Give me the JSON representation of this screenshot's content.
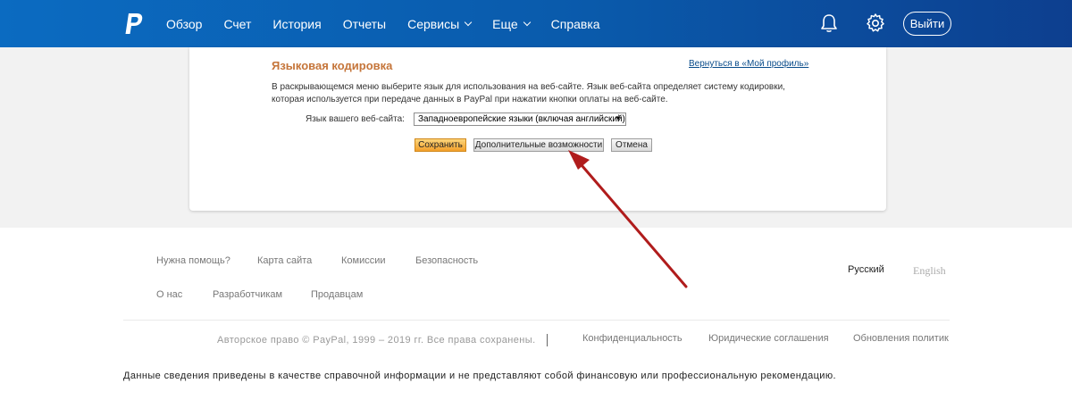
{
  "header": {
    "nav": [
      {
        "label": "Обзор",
        "has_dropdown": false
      },
      {
        "label": "Счет",
        "has_dropdown": false
      },
      {
        "label": "История",
        "has_dropdown": false
      },
      {
        "label": "Отчеты",
        "has_dropdown": false
      },
      {
        "label": "Сервисы",
        "has_dropdown": true
      },
      {
        "label": "Еще",
        "has_dropdown": true
      },
      {
        "label": "Справка",
        "has_dropdown": false
      }
    ],
    "logout_label": "Выйти",
    "icons": [
      "paypal-logo",
      "bell-icon",
      "gear-icon"
    ]
  },
  "section": {
    "title": "Языковая кодировка",
    "back_link": "Вернуться в «Мой профиль»",
    "description": "В раскрывающемся меню выберите язык для использования на веб-сайте. Язык веб-сайта определяет систему кодировки, которая используется при передаче данных в PayPal при нажатии кнопки оплаты на веб-сайте.",
    "language_label": "Язык вашего веб-сайта:",
    "language_value": "Западноевропейские языки (включая английский)",
    "buttons": {
      "save": "Сохранить",
      "more": "Дополнительные возможности",
      "cancel": "Отмена"
    }
  },
  "footer": {
    "links_row1": [
      "Нужна помощь?",
      "Карта сайта",
      "Комиссии",
      "Безопасность"
    ],
    "links_row2": [
      "О нас",
      "Разработчикам",
      "Продавцам"
    ],
    "languages": {
      "active": "Русский",
      "other": "English"
    },
    "copyright": "Авторское право © PayPal, 1999 – 2019 гг. Все права сохранены.",
    "legal_links": [
      "Конфиденциальность",
      "Юридические соглашения",
      "Обновления политик"
    ],
    "disclaimer": "Данные сведения приведены в качестве справочной информации и не представляют собой финансовую или профессиональную рекомендацию."
  },
  "colors": {
    "header_blue": "#0b6bc1",
    "section_title": "#c5753a",
    "link": "#084b8a",
    "annotation_arrow": "#b01c1c"
  }
}
